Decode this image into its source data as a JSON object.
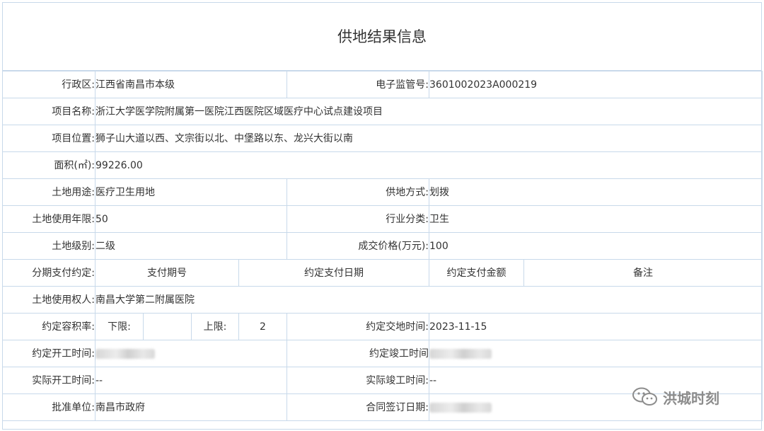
{
  "title": "供地结果信息",
  "row_district": {
    "label": "行政区:",
    "value": "江西省南昌市本级",
    "label2": "电子监管号:",
    "value2": "3601002023A000219"
  },
  "row_project_name": {
    "label": "项目名称:",
    "value": "浙江大学医学院附属第一医院江西医院区域医疗中心试点建设项目"
  },
  "row_location": {
    "label": "项目位置:",
    "value": "狮子山大道以西、文宗街以北、中堡路以东、龙兴大街以南"
  },
  "row_area": {
    "label": "面积(㎡):",
    "value": "99226.00"
  },
  "row_use": {
    "label": "土地用途:",
    "value": "医疗卫生用地",
    "label2": "供地方式:",
    "value2": "划拨"
  },
  "row_term": {
    "label": "土地使用年限:",
    "value": "50",
    "label2": "行业分类:",
    "value2": "卫生"
  },
  "row_grade": {
    "label": "土地级别:",
    "value": "二级",
    "label2": "成交价格(万元):",
    "value2": "100"
  },
  "row_installment": {
    "label": "分期支付约定:",
    "col1": "支付期号",
    "col2": "约定支付日期",
    "col3": "约定支付金额",
    "col4": "备注"
  },
  "row_owner": {
    "label": "土地使用权人:",
    "value": "南昌大学第二附属医院"
  },
  "row_far": {
    "label": "约定容积率:",
    "lower_label": "下限:",
    "lower_value": "",
    "upper_label": "上限:",
    "upper_value": "2",
    "label2": "约定交地时间:",
    "value2": "2023-11-15"
  },
  "row_start": {
    "label": "约定开工时间:",
    "value": "",
    "label2": "约定竣工时间",
    "value2": ""
  },
  "row_actual": {
    "label": "实际开工时间:",
    "value": "--",
    "label2": "实际竣工时间:",
    "value2": "--"
  },
  "row_approve": {
    "label": "批准单位:",
    "value": "南昌市政府",
    "label2": "合同签订日期:",
    "value2": ""
  },
  "watermark": {
    "text": "洪城时刻",
    "icon": "wechat-icon"
  },
  "colors": {
    "border": "#c8d9ea",
    "text": "#333333",
    "watermark": "#8c8c8c"
  }
}
